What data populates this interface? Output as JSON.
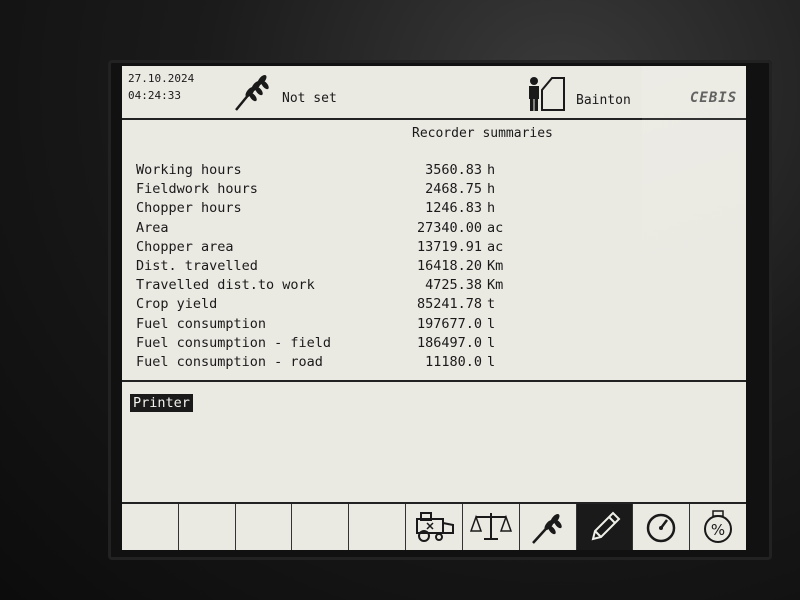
{
  "header": {
    "date": "27.10.2024",
    "time": "04:24:33",
    "crop": "Not set",
    "operator": "Bainton",
    "brand": "CEBIS"
  },
  "page": {
    "title": "Recorder summaries"
  },
  "summaries": [
    {
      "label": "Working hours",
      "value": "3560.83",
      "unit": "h"
    },
    {
      "label": "Fieldwork hours",
      "value": "2468.75",
      "unit": "h"
    },
    {
      "label": "Chopper hours",
      "value": "1246.83",
      "unit": "h"
    },
    {
      "label": "Area",
      "value": "27340.00",
      "unit": "ac"
    },
    {
      "label": "Chopper area",
      "value": "13719.91",
      "unit": "ac"
    },
    {
      "label": "Dist. travelled",
      "value": "16418.20",
      "unit": "Km"
    },
    {
      "label": "Travelled dist.to work",
      "value": "4725.38",
      "unit": "Km"
    },
    {
      "label": "Crop yield",
      "value": "85241.78",
      "unit": "t"
    },
    {
      "label": "Fuel consumption",
      "value": "197677.0",
      "unit": "l"
    },
    {
      "label": "Fuel consumption - field",
      "value": "186497.0",
      "unit": "l"
    },
    {
      "label": "Fuel consumption - road",
      "value": "11180.0",
      "unit": "l"
    }
  ],
  "printer": {
    "label": "Printer"
  },
  "softkeys": [
    {
      "icon": "empty"
    },
    {
      "icon": "empty"
    },
    {
      "icon": "empty"
    },
    {
      "icon": "empty"
    },
    {
      "icon": "empty"
    },
    {
      "icon": "harvester-icon"
    },
    {
      "icon": "scales-icon"
    },
    {
      "icon": "crop-icon"
    },
    {
      "icon": "pencil-icon",
      "active": true
    },
    {
      "icon": "gauge-icon"
    },
    {
      "icon": "percent-icon"
    }
  ]
}
